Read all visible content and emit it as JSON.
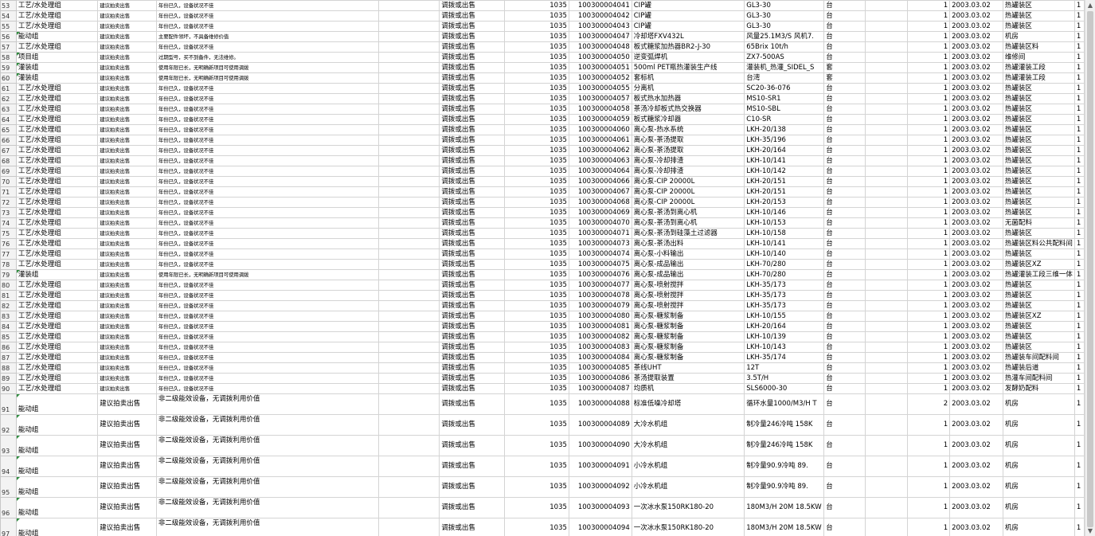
{
  "sheet": {
    "columns": [
      "rownum",
      "group",
      "suggestion",
      "reason",
      "blank",
      "method",
      "code",
      "asset_no",
      "name",
      "spec",
      "unit",
      "blank2",
      "qty",
      "date",
      "location",
      "extra"
    ],
    "rows": [
      {
        "n": "53",
        "g": "工艺/水处理组",
        "s": "建议拍卖出售",
        "r": "年份已久，设备状况不佳",
        "m": "调拨或出售",
        "c": "1035",
        "a": "100300004041",
        "nm": "CIP罐",
        "sp": "GL3-30",
        "u": "台",
        "q": "1",
        "d": "2003.03.02",
        "l": "热罐装区",
        "e": "1"
      },
      {
        "n": "54",
        "g": "工艺/水处理组",
        "s": "建议拍卖出售",
        "r": "年份已久，设备状况不佳",
        "m": "调拨或出售",
        "c": "1035",
        "a": "100300004042",
        "nm": "CIP罐",
        "sp": "GL3-30",
        "u": "台",
        "q": "1",
        "d": "2003.03.02",
        "l": "热罐装区",
        "e": "1"
      },
      {
        "n": "55",
        "g": "工艺/水处理组",
        "s": "建议拍卖出售",
        "r": "年份已久，设备状况不佳",
        "m": "调拨或出售",
        "c": "1035",
        "a": "100300004043",
        "nm": "CIP罐",
        "sp": "GL3-30",
        "u": "台",
        "q": "1",
        "d": "2003.03.02",
        "l": "热罐装区",
        "e": "1"
      },
      {
        "n": "56",
        "g": "能动组",
        "s": "建议拍卖出售",
        "r": "主要配件领坏，不具备维修价值",
        "m": "调拨或出售",
        "c": "1035",
        "a": "100300004047",
        "nm": "冷却塔FXV432L",
        "sp": "风量25.1M3/S 风机7.",
        "u": "台",
        "q": "1",
        "d": "2003.03.02",
        "l": "机房",
        "e": "1",
        "mark": true
      },
      {
        "n": "57",
        "g": "工艺/水处理组",
        "s": "建议拍卖出售",
        "r": "年份已久，设备状况不佳",
        "m": "调拨或出售",
        "c": "1035",
        "a": "100300004048",
        "nm": "板式糖浆加热器BR2-J-30",
        "sp": "65Brix 10t/h",
        "u": "台",
        "q": "1",
        "d": "2003.03.02",
        "l": "热罐装区料",
        "e": "1"
      },
      {
        "n": "58",
        "g": "项目组",
        "s": "建议拍卖出售",
        "r": "过期型号，买不到备件，无法维修。",
        "m": "调拨或出售",
        "c": "1035",
        "a": "100300004050",
        "nm": "逆变弧焊机",
        "sp": "ZX7-500AS",
        "u": "台",
        "q": "1",
        "d": "2003.03.02",
        "l": "维修间",
        "e": "1",
        "mark": true
      },
      {
        "n": "59",
        "g": "灌装组",
        "s": "建议拍卖出售",
        "r": "使用年限已长，无明确新项目可使用调拨",
        "m": "调拨或出售",
        "c": "1035",
        "a": "100300004051",
        "nm": "500ml PET瓶热灌装生产线",
        "sp": "灌装机_热灌_SIDEL_S",
        "u": "套",
        "q": "1",
        "d": "2003.03.02",
        "l": "热罐灌装工段",
        "e": "1",
        "mark": true
      },
      {
        "n": "60",
        "g": "灌装组",
        "s": "建议拍卖出售",
        "r": "使用年限已长，无明确新项目可使用调拨",
        "m": "调拨或出售",
        "c": "1035",
        "a": "100300004052",
        "nm": "套标机",
        "sp": "台湾",
        "u": "套",
        "q": "1",
        "d": "2003.03.02",
        "l": "热罐灌装工段",
        "e": "1",
        "mark": true
      },
      {
        "n": "61",
        "g": "工艺/水处理组",
        "s": "建议拍卖出售",
        "r": "年份已久，设备状况不佳",
        "m": "调拨或出售",
        "c": "1035",
        "a": "100300004055",
        "nm": "分离机",
        "sp": "SC20-36-076",
        "u": "台",
        "q": "1",
        "d": "2003.03.02",
        "l": "热罐装区",
        "e": "1"
      },
      {
        "n": "62",
        "g": "工艺/水处理组",
        "s": "建议拍卖出售",
        "r": "年份已久，设备状况不佳",
        "m": "调拨或出售",
        "c": "1035",
        "a": "100300004057",
        "nm": "板式热水加热器",
        "sp": "MS10-SR1",
        "u": "台",
        "q": "1",
        "d": "2003.03.02",
        "l": "热罐装区",
        "e": "1"
      },
      {
        "n": "63",
        "g": "工艺/水处理组",
        "s": "建议拍卖出售",
        "r": "年份已久，设备状况不佳",
        "m": "调拨或出售",
        "c": "1035",
        "a": "100300004058",
        "nm": "茶汤冷却板式热交换器",
        "sp": "MS10-SBL",
        "u": "台",
        "q": "1",
        "d": "2003.03.02",
        "l": "热罐装区",
        "e": "1"
      },
      {
        "n": "64",
        "g": "工艺/水处理组",
        "s": "建议拍卖出售",
        "r": "年份已久，设备状况不佳",
        "m": "调拨或出售",
        "c": "1035",
        "a": "100300004059",
        "nm": "板式糖浆冷却器",
        "sp": "C10-SR",
        "u": "台",
        "q": "1",
        "d": "2003.03.02",
        "l": "热罐装区",
        "e": "1"
      },
      {
        "n": "65",
        "g": "工艺/水处理组",
        "s": "建议拍卖出售",
        "r": "年份已久，设备状况不佳",
        "m": "调拨或出售",
        "c": "1035",
        "a": "100300004060",
        "nm": "离心泵-热水系统",
        "sp": "LKH-20/138",
        "u": "台",
        "q": "1",
        "d": "2003.03.02",
        "l": "热罐装区",
        "e": "1"
      },
      {
        "n": "66",
        "g": "工艺/水处理组",
        "s": "建议拍卖出售",
        "r": "年份已久，设备状况不佳",
        "m": "调拨或出售",
        "c": "1035",
        "a": "100300004061",
        "nm": "离心泵-茶汤提取",
        "sp": "LKH-35/196",
        "u": "台",
        "q": "1",
        "d": "2003.03.02",
        "l": "热罐装区",
        "e": "1"
      },
      {
        "n": "67",
        "g": "工艺/水处理组",
        "s": "建议拍卖出售",
        "r": "年份已久，设备状况不佳",
        "m": "调拨或出售",
        "c": "1035",
        "a": "100300004062",
        "nm": "离心泵-茶汤提取",
        "sp": "LKH-20/164",
        "u": "台",
        "q": "1",
        "d": "2003.03.02",
        "l": "热罐装区",
        "e": "1"
      },
      {
        "n": "68",
        "g": "工艺/水处理组",
        "s": "建议拍卖出售",
        "r": "年份已久，设备状况不佳",
        "m": "调拨或出售",
        "c": "1035",
        "a": "100300004063",
        "nm": "离心泵-冷却排渣",
        "sp": "LKH-10/141",
        "u": "台",
        "q": "1",
        "d": "2003.03.02",
        "l": "热罐装区",
        "e": "1"
      },
      {
        "n": "69",
        "g": "工艺/水处理组",
        "s": "建议拍卖出售",
        "r": "年份已久，设备状况不佳",
        "m": "调拨或出售",
        "c": "1035",
        "a": "100300004064",
        "nm": "离心泵-冷却排渣",
        "sp": "LKH-10/142",
        "u": "台",
        "q": "1",
        "d": "2003.03.02",
        "l": "热罐装区",
        "e": "1"
      },
      {
        "n": "70",
        "g": "工艺/水处理组",
        "s": "建议拍卖出售",
        "r": "年份已久，设备状况不佳",
        "m": "调拨或出售",
        "c": "1035",
        "a": "100300004066",
        "nm": "离心泵-CIP 20000L",
        "sp": "LKH-20/151",
        "u": "台",
        "q": "1",
        "d": "2003.03.02",
        "l": "热罐装区",
        "e": "1"
      },
      {
        "n": "71",
        "g": "工艺/水处理组",
        "s": "建议拍卖出售",
        "r": "年份已久，设备状况不佳",
        "m": "调拨或出售",
        "c": "1035",
        "a": "100300004067",
        "nm": "离心泵-CIP 20000L",
        "sp": "LKH-20/151",
        "u": "台",
        "q": "1",
        "d": "2003.03.02",
        "l": "热罐装区",
        "e": "1"
      },
      {
        "n": "72",
        "g": "工艺/水处理组",
        "s": "建议拍卖出售",
        "r": "年份已久，设备状况不佳",
        "m": "调拨或出售",
        "c": "1035",
        "a": "100300004068",
        "nm": "离心泵-CIP 20000L",
        "sp": "LKH-20/153",
        "u": "台",
        "q": "1",
        "d": "2003.03.02",
        "l": "热罐装区",
        "e": "1"
      },
      {
        "n": "73",
        "g": "工艺/水处理组",
        "s": "建议拍卖出售",
        "r": "年份已久，设备状况不佳",
        "m": "调拨或出售",
        "c": "1035",
        "a": "100300004069",
        "nm": "离心泵-茶汤到离心机",
        "sp": "LKH-10/146",
        "u": "台",
        "q": "1",
        "d": "2003.03.02",
        "l": "热罐装区",
        "e": "1"
      },
      {
        "n": "74",
        "g": "工艺/水处理组",
        "s": "建议拍卖出售",
        "r": "年份已久，设备状况不佳",
        "m": "调拨或出售",
        "c": "1035",
        "a": "100300004070",
        "nm": "离心泵-茶汤到离心机",
        "sp": "LKH-10/153",
        "u": "台",
        "q": "1",
        "d": "2003.03.02",
        "l": "无菌配料",
        "e": "1"
      },
      {
        "n": "75",
        "g": "工艺/水处理组",
        "s": "建议拍卖出售",
        "r": "年份已久，设备状况不佳",
        "m": "调拨或出售",
        "c": "1035",
        "a": "100300004071",
        "nm": "离心泵-茶汤到硅藻土过滤器",
        "sp": "LKH-10/158",
        "u": "台",
        "q": "1",
        "d": "2003.03.02",
        "l": "热罐装区",
        "e": "1"
      },
      {
        "n": "76",
        "g": "工艺/水处理组",
        "s": "建议拍卖出售",
        "r": "年份已久，设备状况不佳",
        "m": "调拨或出售",
        "c": "1035",
        "a": "100300004073",
        "nm": "离心泵-茶汤出料",
        "sp": "LKH-10/141",
        "u": "台",
        "q": "1",
        "d": "2003.03.02",
        "l": "热罐装区料公共配料间",
        "e": "1"
      },
      {
        "n": "77",
        "g": "工艺/水处理组",
        "s": "建议拍卖出售",
        "r": "年份已久，设备状况不佳",
        "m": "调拨或出售",
        "c": "1035",
        "a": "100300004074",
        "nm": "离心泵-小料输出",
        "sp": "LKH-10/140",
        "u": "台",
        "q": "1",
        "d": "2003.03.02",
        "l": "热罐装区",
        "e": "1"
      },
      {
        "n": "78",
        "g": "工艺/水处理组",
        "s": "建议拍卖出售",
        "r": "年份已久，设备状况不佳",
        "m": "调拨或出售",
        "c": "1035",
        "a": "100300004075",
        "nm": "离心泵-成品输出",
        "sp": "LKH-70/280",
        "u": "台",
        "q": "1",
        "d": "2003.03.02",
        "l": "热罐装区XZ",
        "e": "1"
      },
      {
        "n": "79",
        "g": "灌装组",
        "s": "建议拍卖出售",
        "r": "使用年限已长，无明确新项目可使用调拨",
        "m": "调拨或出售",
        "c": "1035",
        "a": "100300004076",
        "nm": "离心泵-成品输出",
        "sp": "LKH-70/280",
        "u": "台",
        "q": "1",
        "d": "2003.03.02",
        "l": "热罐灌装工段三维一体",
        "e": "1",
        "mark": true
      },
      {
        "n": "80",
        "g": "工艺/水处理组",
        "s": "建议拍卖出售",
        "r": "年份已久，设备状况不佳",
        "m": "调拨或出售",
        "c": "1035",
        "a": "100300004077",
        "nm": "离心泵-喷射搅拌",
        "sp": "LKH-35/173",
        "u": "台",
        "q": "1",
        "d": "2003.03.02",
        "l": "热罐装区",
        "e": "1"
      },
      {
        "n": "81",
        "g": "工艺/水处理组",
        "s": "建议拍卖出售",
        "r": "年份已久，设备状况不佳",
        "m": "调拨或出售",
        "c": "1035",
        "a": "100300004078",
        "nm": "离心泵-喷射搅拌",
        "sp": "LKH-35/173",
        "u": "台",
        "q": "1",
        "d": "2003.03.02",
        "l": "热罐装区",
        "e": "1"
      },
      {
        "n": "82",
        "g": "工艺/水处理组",
        "s": "建议拍卖出售",
        "r": "年份已久，设备状况不佳",
        "m": "调拨或出售",
        "c": "1035",
        "a": "100300004079",
        "nm": "离心泵-喷射搅拌",
        "sp": "LKH-35/173",
        "u": "台",
        "q": "1",
        "d": "2003.03.02",
        "l": "热罐装区",
        "e": "1"
      },
      {
        "n": "83",
        "g": "工艺/水处理组",
        "s": "建议拍卖出售",
        "r": "年份已久，设备状况不佳",
        "m": "调拨或出售",
        "c": "1035",
        "a": "100300004080",
        "nm": "离心泵-糖浆制备",
        "sp": "LKH-10/155",
        "u": "台",
        "q": "1",
        "d": "2003.03.02",
        "l": "热罐装区XZ",
        "e": "1"
      },
      {
        "n": "84",
        "g": "工艺/水处理组",
        "s": "建议拍卖出售",
        "r": "年份已久，设备状况不佳",
        "m": "调拨或出售",
        "c": "1035",
        "a": "100300004081",
        "nm": "离心泵-糖浆制备",
        "sp": "LKH-20/164",
        "u": "台",
        "q": "1",
        "d": "2003.03.02",
        "l": "热罐装区",
        "e": "1"
      },
      {
        "n": "85",
        "g": "工艺/水处理组",
        "s": "建议拍卖出售",
        "r": "年份已久，设备状况不佳",
        "m": "调拨或出售",
        "c": "1035",
        "a": "100300004082",
        "nm": "离心泵-糖浆制备",
        "sp": "LKH-10/139",
        "u": "台",
        "q": "1",
        "d": "2003.03.02",
        "l": "热罐装区",
        "e": "1"
      },
      {
        "n": "86",
        "g": "工艺/水处理组",
        "s": "建议拍卖出售",
        "r": "年份已久，设备状况不佳",
        "m": "调拨或出售",
        "c": "1035",
        "a": "100300004083",
        "nm": "离心泵-糖浆制备",
        "sp": "LKH-10/143",
        "u": "台",
        "q": "1",
        "d": "2003.03.02",
        "l": "热罐装区",
        "e": "1"
      },
      {
        "n": "87",
        "g": "工艺/水处理组",
        "s": "建议拍卖出售",
        "r": "年份已久，设备状况不佳",
        "m": "调拨或出售",
        "c": "1035",
        "a": "100300004084",
        "nm": "离心泵-糖浆制备",
        "sp": "LKH-35/174",
        "u": "台",
        "q": "1",
        "d": "2003.03.02",
        "l": "热罐装车间配料间",
        "e": "1"
      },
      {
        "n": "88",
        "g": "工艺/水处理组",
        "s": "建议拍卖出售",
        "r": "年份已久，设备状况不佳",
        "m": "调拨或出售",
        "c": "1035",
        "a": "100300004085",
        "nm": "茶线UHT",
        "sp": "12T",
        "u": "台",
        "q": "1",
        "d": "2003.03.02",
        "l": "热罐装后道",
        "e": "1"
      },
      {
        "n": "89",
        "g": "工艺/水处理组",
        "s": "建议拍卖出售",
        "r": "年份已久，设备状况不佳",
        "m": "调拨或出售",
        "c": "1035",
        "a": "100300004086",
        "nm": "茶汤提取装置",
        "sp": "3.5T/H",
        "u": "台",
        "q": "1",
        "d": "2003.03.02",
        "l": "热灌车间配料间",
        "e": "1"
      },
      {
        "n": "90",
        "g": "工艺/水处理组",
        "s": "建议拍卖出售",
        "r": "年份已久，设备状况不佳",
        "m": "调拨或出售",
        "c": "1035",
        "a": "100300004087",
        "nm": "均质机",
        "sp": "SLS6000-30",
        "u": "台",
        "q": "1",
        "d": "2003.03.02",
        "l": "发酵奶配料",
        "e": "1"
      },
      {
        "n": "91",
        "g": "能动组",
        "s": "建议拍卖出售",
        "r": "非二级能效设备，无调拨利用价值",
        "m": "调拨或出售",
        "c": "1035",
        "a": "100300004088",
        "nm": "标准低噪冷却塔",
        "sp": "循环水量1000/M3/H T",
        "u": "台",
        "q": "2",
        "d": "2003.03.02",
        "l": "机房",
        "e": "1",
        "mark": true,
        "tall": true
      },
      {
        "n": "92",
        "g": "能动组",
        "s": "建议拍卖出售",
        "r": "非二级能效设备，无调拨利用价值",
        "m": "调拨或出售",
        "c": "1035",
        "a": "100300004089",
        "nm": "大冷水机组",
        "sp": "制冷量246冷吨  158K",
        "u": "台",
        "q": "1",
        "d": "2003.03.02",
        "l": "机房",
        "e": "1",
        "mark": true,
        "tall": true
      },
      {
        "n": "93",
        "g": "能动组",
        "s": "建议拍卖出售",
        "r": "非二级能效设备，无调拨利用价值",
        "m": "调拨或出售",
        "c": "1035",
        "a": "100300004090",
        "nm": "大冷水机组",
        "sp": "制冷量246冷吨  158K",
        "u": "台",
        "q": "1",
        "d": "2003.03.02",
        "l": "机房",
        "e": "1",
        "mark": true,
        "tall": true
      },
      {
        "n": "94",
        "g": "能动组",
        "s": "建议拍卖出售",
        "r": "非二级能效设备，无调拨利用价值",
        "m": "调拨或出售",
        "c": "1035",
        "a": "100300004091",
        "nm": "小冷水机组",
        "sp": "制冷量90.9冷吨  89.",
        "u": "台",
        "q": "1",
        "d": "2003.03.02",
        "l": "机房",
        "e": "1",
        "mark": true,
        "tall": true
      },
      {
        "n": "95",
        "g": "能动组",
        "s": "建议拍卖出售",
        "r": "非二级能效设备，无调拨利用价值",
        "m": "调拨或出售",
        "c": "1035",
        "a": "100300004092",
        "nm": "小冷水机组",
        "sp": "制冷量90.9冷吨  89.",
        "u": "台",
        "q": "1",
        "d": "2003.03.02",
        "l": "机房",
        "e": "1",
        "mark": true,
        "tall": true
      },
      {
        "n": "96",
        "g": "能动组",
        "s": "建议拍卖出售",
        "r": "非二级能效设备，无调拨利用价值",
        "m": "调拨或出售",
        "c": "1035",
        "a": "100300004093",
        "nm": "一次冰水泵150RK180-20",
        "sp": "180M3/H  20M 18.5KW",
        "u": "台",
        "q": "1",
        "d": "2003.03.02",
        "l": "机房",
        "e": "1",
        "mark": true,
        "tall": true
      },
      {
        "n": "97",
        "g": "能动组",
        "s": "建议拍卖出售",
        "r": "非二级能效设备，无调拨利用价值",
        "m": "调拨或出售",
        "c": "1035",
        "a": "100300004094",
        "nm": "一次冰水泵150RK180-20",
        "sp": "180M3/H  20M 18.5KW",
        "u": "台",
        "q": "1",
        "d": "2003.03.02",
        "l": "机房",
        "e": "1",
        "mark": true,
        "tall": true
      }
    ]
  },
  "icons": {
    "scroll_up": "triangle-up-icon",
    "scroll_down": "triangle-down-icon"
  },
  "colors": {
    "grid": "#d4d4d4",
    "header_bg": "#f3f3f3",
    "highlight": "#fff200",
    "comment_mark": "#2e8b3e"
  }
}
